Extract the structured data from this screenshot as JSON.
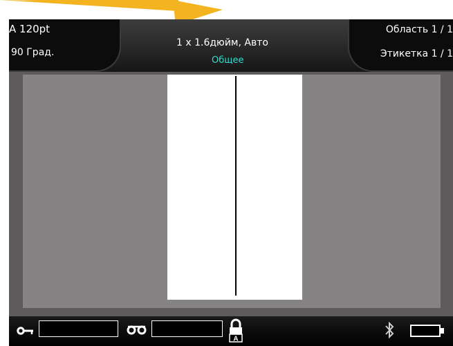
{
  "header": {
    "font_size": "A 120pt",
    "rotation": "90 Град.",
    "label_size": "1 x 1.6дюйм, Авто",
    "label_type": "Общее",
    "area": "Область 1 / 1",
    "label": "Этикетка 1 / 1"
  },
  "footer": {
    "key_field_value": "",
    "tape_field_value": "",
    "lock_icon": "lock-icon",
    "bluetooth_icon": "bluetooth-icon",
    "battery_icon": "battery-icon"
  },
  "colors": {
    "accent_cyan": "#33ddd0",
    "arrow": "#f4b321",
    "screen_bg": "#5d5b5c",
    "canvas_bg": "#858384"
  }
}
